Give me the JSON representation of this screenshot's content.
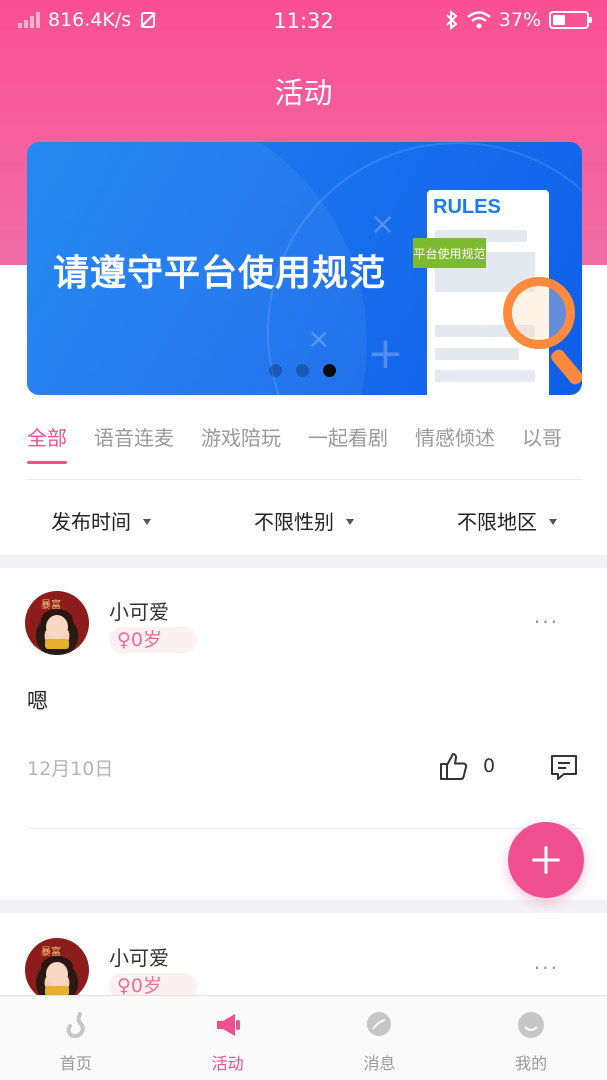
{
  "status_bar": {
    "speed": "816.4K/s",
    "time": "11:32",
    "battery": "37%",
    "battery_level": 0.37
  },
  "header": {
    "title": "活动"
  },
  "banner": {
    "headline": "请遵守平台使用规范",
    "doc_title": "RULES",
    "tag": "平台使用规范",
    "pages": 3,
    "active_page": 3
  },
  "tabs": [
    {
      "label": "全部",
      "active": true
    },
    {
      "label": "语音连麦",
      "active": false
    },
    {
      "label": "游戏陪玩",
      "active": false
    },
    {
      "label": "一起看剧",
      "active": false
    },
    {
      "label": "情感倾述",
      "active": false
    },
    {
      "label": "以哥",
      "active": false
    }
  ],
  "filters": {
    "time": "发布时间",
    "gender": "不限性别",
    "region": "不限地区"
  },
  "posts": [
    {
      "username": "小可爱",
      "gender_age": "♀0岁",
      "content": "嗯",
      "date": "12月10日",
      "likes": "0",
      "more": "···"
    },
    {
      "username": "小可爱",
      "gender_age": "♀0岁",
      "more": "···"
    }
  ],
  "avatar_text": "暴富",
  "nav": [
    {
      "label": "首页",
      "icon": "home-icon",
      "active": false
    },
    {
      "label": "活动",
      "icon": "megaphone-icon",
      "active": true
    },
    {
      "label": "消息",
      "icon": "message-icon",
      "active": false
    },
    {
      "label": "我的",
      "icon": "profile-icon",
      "active": false
    }
  ],
  "colors": {
    "accent": "#f0508f",
    "header_top": "#fb4f94",
    "banner_blue": "#1a74ee"
  }
}
